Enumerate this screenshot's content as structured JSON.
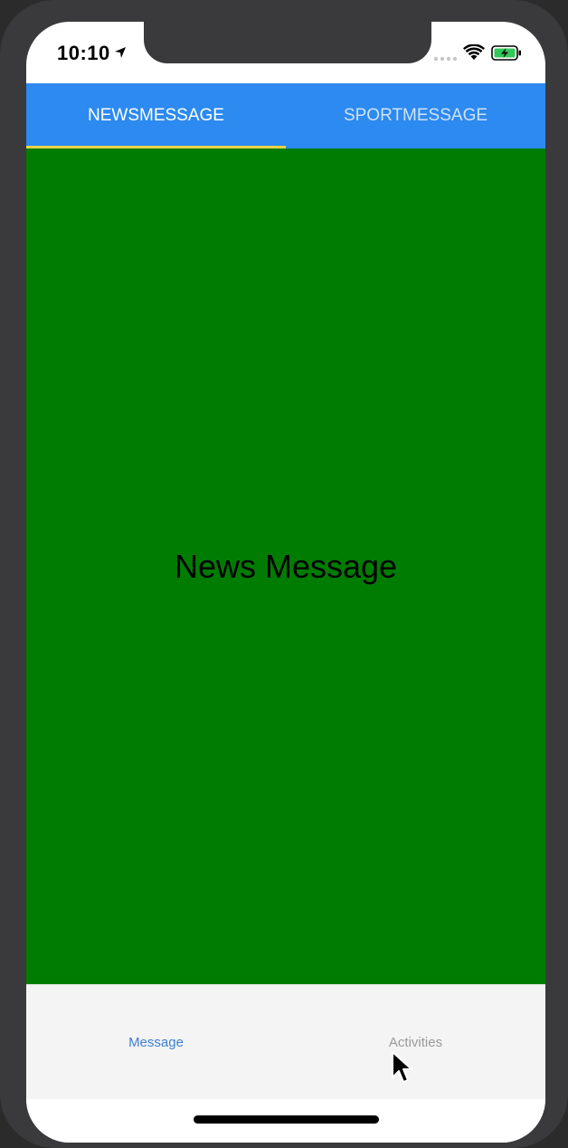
{
  "status_bar": {
    "time": "10:10",
    "location_icon": "location-arrow-icon",
    "signal_icon": "cellular-signal-icon",
    "wifi_icon": "wifi-icon",
    "battery_icon": "battery-charging-icon"
  },
  "top_tabs": {
    "items": [
      {
        "label": "NEWSMESSAGE",
        "active": true
      },
      {
        "label": "SPORTMESSAGE",
        "active": false
      }
    ],
    "colors": {
      "bar": "#2c8af0",
      "indicator": "#f3d34a"
    }
  },
  "content": {
    "title": "News Message",
    "background": "#017c02"
  },
  "bottom_tabs": {
    "items": [
      {
        "label": "Message",
        "active": true
      },
      {
        "label": "Activities",
        "active": false
      }
    ],
    "colors": {
      "active": "#3d7fd4",
      "inactive": "#9a9a9a"
    }
  },
  "cursor_icon": "mouse-pointer-icon"
}
